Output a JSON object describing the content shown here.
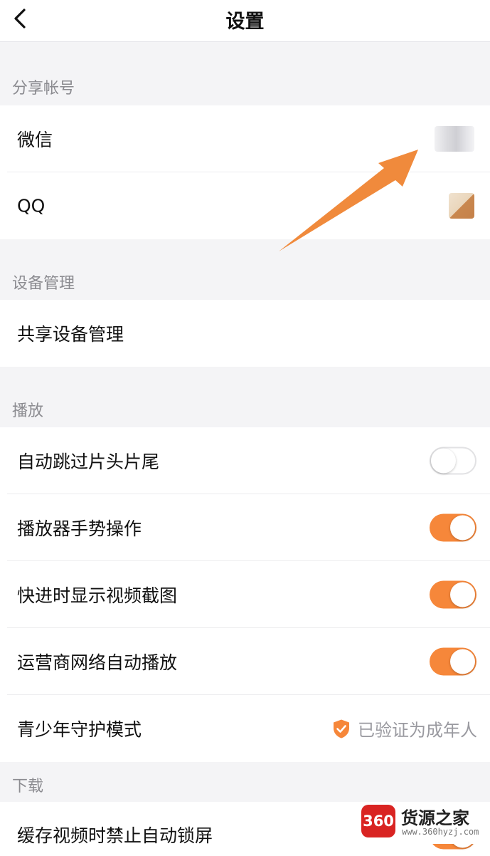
{
  "header": {
    "title": "设置",
    "back_icon": "chevron-left-icon"
  },
  "sections": {
    "share_accounts": {
      "header": "分享帐号",
      "items": {
        "wechat": "微信",
        "qq": "QQ"
      }
    },
    "device_management": {
      "header": "设备管理",
      "items": {
        "shared_devices": "共享设备管理"
      }
    },
    "playback": {
      "header": "播放",
      "items": {
        "skip_intro": {
          "label": "自动跳过片头片尾",
          "enabled": false
        },
        "gesture": {
          "label": "播放器手势操作",
          "enabled": true
        },
        "fast_forward_preview": {
          "label": "快进时显示视频截图",
          "enabled": true
        },
        "cellular_autoplay": {
          "label": "运营商网络自动播放",
          "enabled": true
        },
        "youth_mode": {
          "label": "青少年守护模式",
          "status": "已验证为成年人",
          "status_icon": "shield-check-icon"
        }
      }
    },
    "download": {
      "header": "下载",
      "items": {
        "no_auto_lock": "缓存视频时禁止自动锁屏"
      }
    }
  },
  "watermark": {
    "logo": "360",
    "name": "货源之家",
    "url": "www.360hyzj.com"
  },
  "colors": {
    "accent": "#f6873a",
    "background": "#f4f4f6",
    "section_text": "#8b8b90"
  }
}
